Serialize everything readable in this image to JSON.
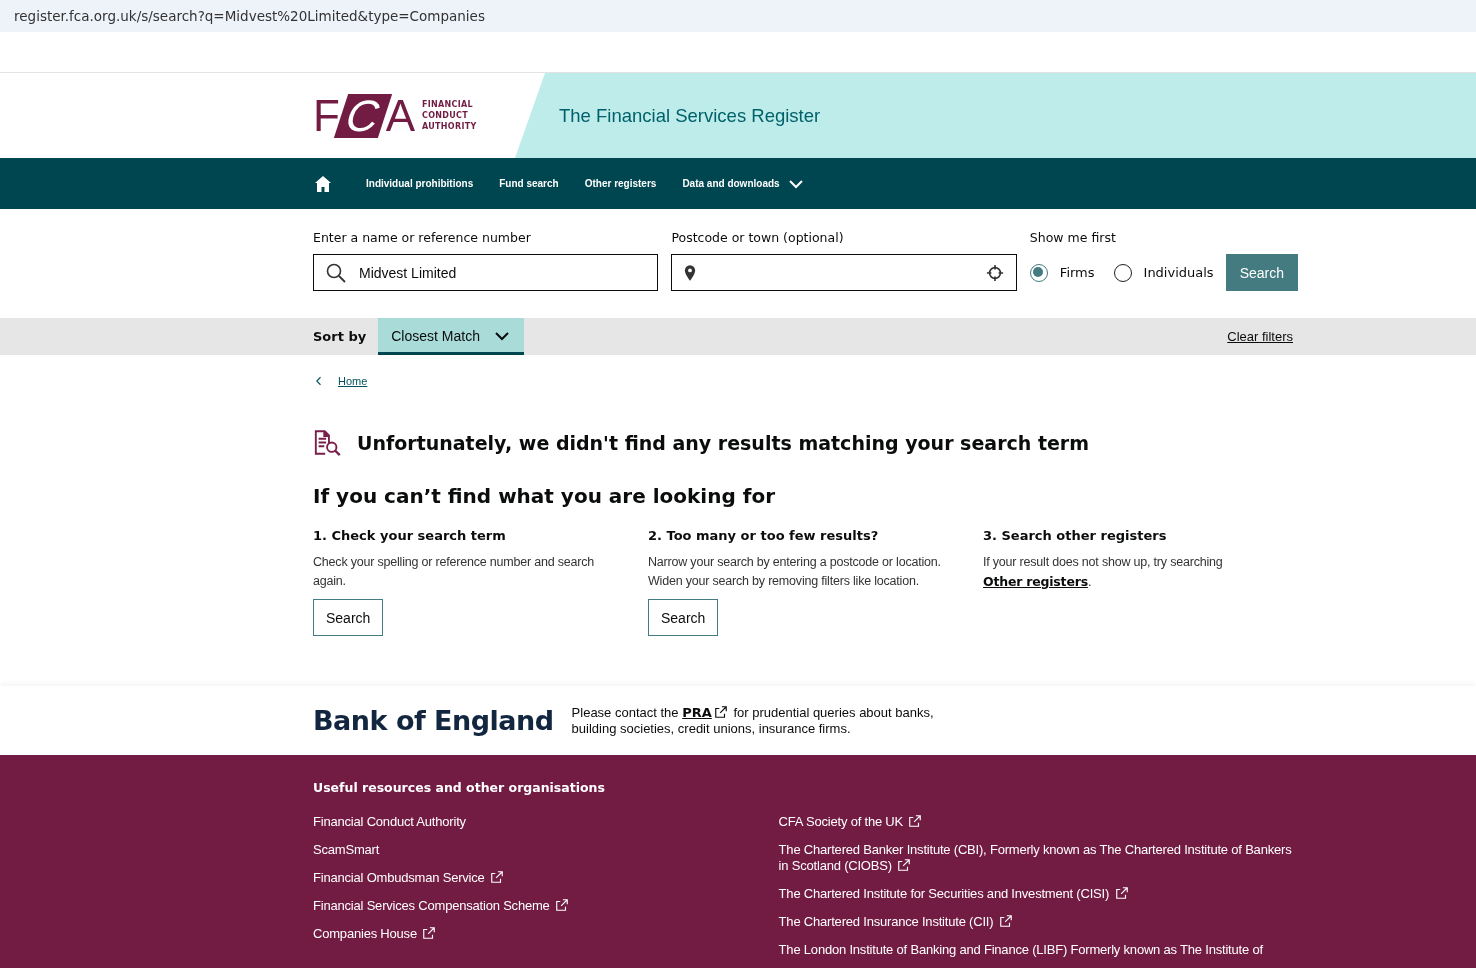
{
  "address_bar": {
    "url": "register.fca.org.uk/s/search?q=Midvest%20Limited&type=Companies"
  },
  "header": {
    "logo": {
      "letters": "FCA",
      "lines": [
        "FINANCIAL",
        "CONDUCT",
        "AUTHORITY"
      ]
    },
    "title": "The Financial Services Register"
  },
  "nav": {
    "items": [
      {
        "kind": "home"
      },
      {
        "kind": "link",
        "label": "Individual prohibitions"
      },
      {
        "kind": "link",
        "label": "Fund search"
      },
      {
        "kind": "link",
        "label": "Other registers"
      },
      {
        "kind": "dropdown",
        "label": "Data and downloads"
      }
    ]
  },
  "search": {
    "name_field": {
      "label": "Enter a name or reference number",
      "value": "Midvest Limited"
    },
    "location_field": {
      "label": "Postcode or town (optional)"
    },
    "show_first": {
      "label": "Show me first",
      "options": [
        {
          "label": "Firms",
          "selected": true
        },
        {
          "label": "Individuals",
          "selected": false
        }
      ]
    },
    "button": "Search"
  },
  "sort_bar": {
    "label": "Sort by",
    "value": "Closest Match",
    "clear": "Clear filters"
  },
  "breadcrumb": {
    "items": [
      "Home"
    ]
  },
  "no_results": {
    "heading": "Unfortunately, we didn't find any results matching your search term"
  },
  "help": {
    "title": "If you can’t find what you are looking for",
    "columns": [
      {
        "title": "1. Check your search term",
        "text": "Check your spelling or reference number and search again.",
        "button": "Search"
      },
      {
        "title": "2. Too many or too few results?",
        "text": "Narrow your search by entering a postcode or location. Widen your search by removing filters like location.",
        "button": "Search"
      },
      {
        "title": "3. Search other registers",
        "text": "If your result does not show up, try searching ",
        "link": "Other registers",
        "text_after": "."
      }
    ]
  },
  "boe": {
    "brand": "Bank of England",
    "text": "Please contact the ",
    "link": "PRA",
    "text_after": " for prudential queries about banks, building societies, credit unions, insurance firms."
  },
  "footer": {
    "heading": "Useful resources and other organisations",
    "columns": [
      [
        {
          "label": "Financial Conduct Authority",
          "external": false
        },
        {
          "label": "ScamSmart",
          "external": false
        },
        {
          "label": "Financial Ombudsman Service",
          "external": true
        },
        {
          "label": "Financial Services Compensation Scheme",
          "external": true
        },
        {
          "label": "Companies House",
          "external": true
        }
      ],
      [
        {
          "label": "CFA Society of the UK",
          "external": true
        },
        {
          "label": "The Chartered Banker Institute (CBI), Formerly known as The Chartered Institute of Bankers in Scotland (CIOBS)",
          "external": true
        },
        {
          "label": "The Chartered Institute for Securities and Investment (CISI)",
          "external": true
        },
        {
          "label": "The Chartered Insurance Institute (CII)",
          "external": true
        },
        {
          "label": "The London Institute of Banking and Finance (LIBF) Formerly known as The Institute of",
          "external": false
        }
      ]
    ]
  }
}
